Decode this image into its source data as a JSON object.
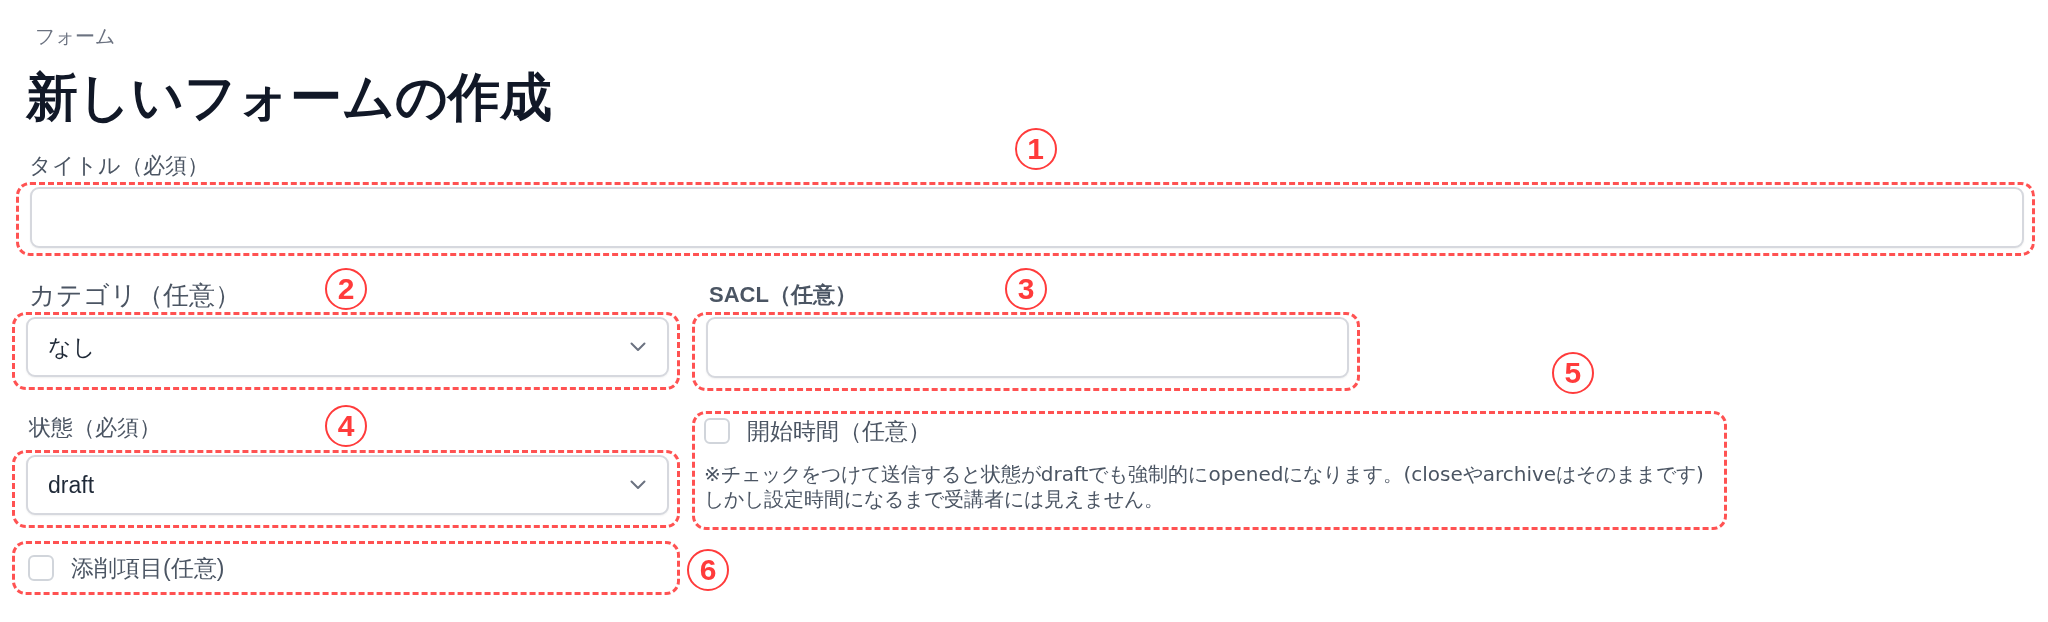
{
  "breadcrumb": "フォーム",
  "heading": "新しいフォームの作成",
  "title_field": {
    "label": "タイトル（必須）",
    "annotation": "1"
  },
  "category_field": {
    "label": "カテゴリ（任意）",
    "value": "なし",
    "annotation": "2"
  },
  "sacl_field": {
    "label": "SACL（任意）",
    "annotation": "3"
  },
  "status_field": {
    "label": "状態（必須）",
    "value": "draft",
    "annotation": "4"
  },
  "start_time": {
    "label": "開始時間（任意）",
    "checked": false,
    "help_text": "※チェックをつけて送信すると状態がdraftでも強制的にopenedになります。(closeやarchiveはそのままです)\nしかし設定時間になるまで受講者には見えません。",
    "annotation": "5"
  },
  "grading_item": {
    "label": "添削項目(任意)",
    "checked": false,
    "annotation": "6"
  }
}
